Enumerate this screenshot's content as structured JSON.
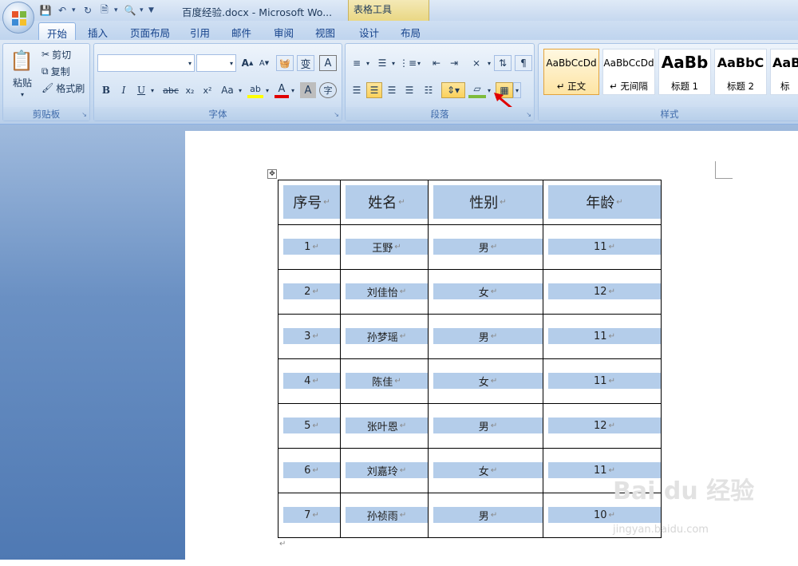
{
  "window": {
    "title": "百度经验.docx - Microsoft Wo...",
    "context_tab_group": "表格工具"
  },
  "tabs": [
    {
      "label": "开始",
      "active": true
    },
    {
      "label": "插入"
    },
    {
      "label": "页面布局"
    },
    {
      "label": "引用"
    },
    {
      "label": "邮件"
    },
    {
      "label": "审阅"
    },
    {
      "label": "视图"
    },
    {
      "label": "设计"
    },
    {
      "label": "布局"
    }
  ],
  "clipboard": {
    "paste": "粘贴",
    "cut": "剪切",
    "copy": "复制",
    "format_painter": "格式刷",
    "label": "剪贴板"
  },
  "font": {
    "label": "字体",
    "bold": "B",
    "italic": "I",
    "underline": "U",
    "strike": "abc",
    "subscript": "x₂",
    "superscript": "x²",
    "change_case": "Aa",
    "phonetic": "变",
    "char_border": "A",
    "char_shading": "A",
    "grow": "A",
    "shrink": "A",
    "enclose": "字"
  },
  "paragraph": {
    "label": "段落"
  },
  "styles": {
    "label": "样式",
    "items": [
      {
        "sample": "AaBbCcDd",
        "name": "↵ 正文"
      },
      {
        "sample": "AaBbCcDd",
        "name": "↵ 无间隔"
      },
      {
        "sample": "AaBb",
        "name": "标题 1"
      },
      {
        "sample": "AaBbC",
        "name": "标题 2"
      },
      {
        "sample": "AaB",
        "name": "标"
      }
    ]
  },
  "table": {
    "headers": [
      "序号",
      "姓名",
      "性别",
      "年龄"
    ],
    "rows": [
      [
        "1",
        "王野",
        "男",
        "11"
      ],
      [
        "2",
        "刘佳怡",
        "女",
        "12"
      ],
      [
        "3",
        "孙梦瑶",
        "男",
        "11"
      ],
      [
        "4",
        "陈佳",
        "女",
        "11"
      ],
      [
        "5",
        "张叶恩",
        "男",
        "12"
      ],
      [
        "6",
        "刘嘉玲",
        "女",
        "11"
      ],
      [
        "7",
        "孙祯雨",
        "男",
        "10"
      ]
    ]
  },
  "watermark": {
    "brand": "Bai du 经验",
    "url": "jingyan.baidu.com"
  },
  "colors": {
    "cell_shading": "#b4cdea",
    "ribbon": "#c4d8ef",
    "workspace": "#6a90c3"
  }
}
